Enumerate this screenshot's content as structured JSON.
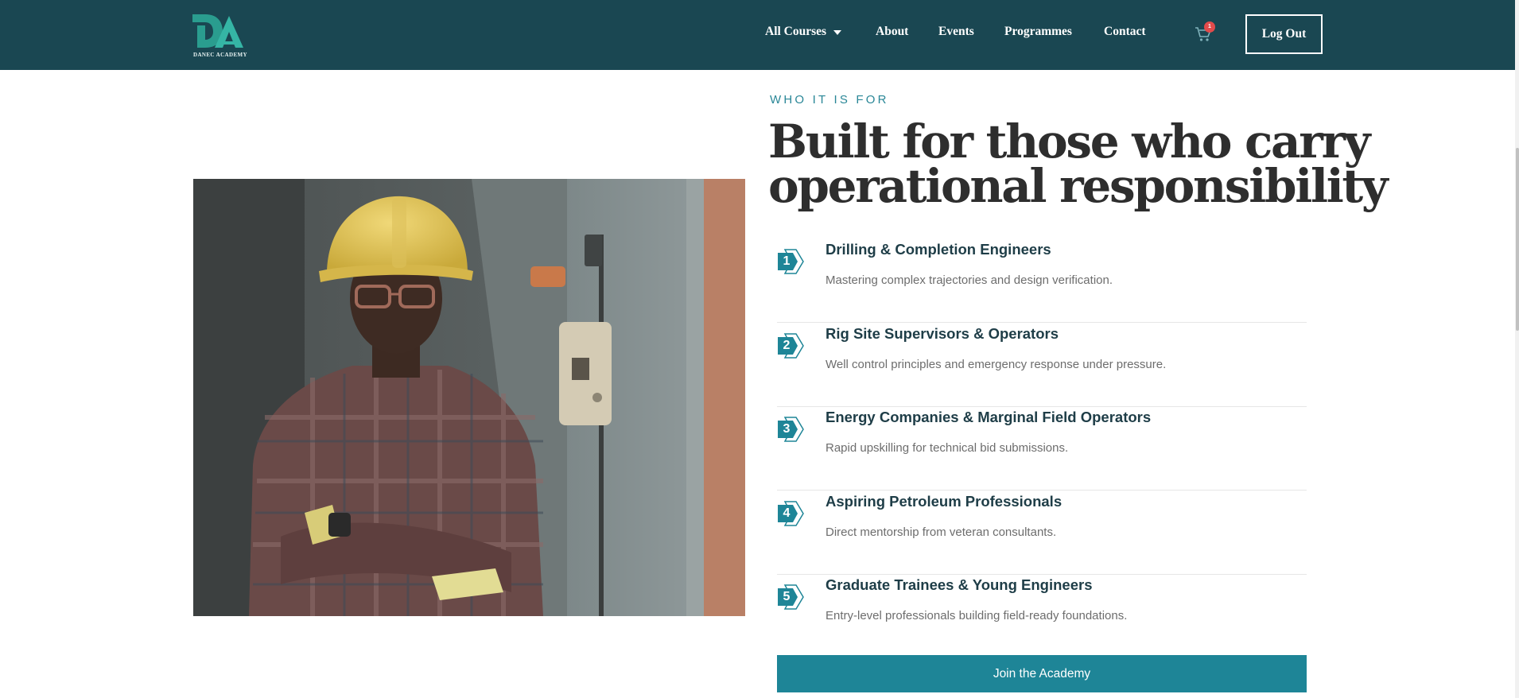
{
  "brand": {
    "logo_text": "DANEC ACADEMY",
    "colors": {
      "nav_bg": "#1a4752",
      "accent": "#1e8597",
      "logo_teal": "#2a9d8f"
    }
  },
  "nav": {
    "items": [
      {
        "label": "All Courses",
        "has_dropdown": true
      },
      {
        "label": "About"
      },
      {
        "label": "Events"
      },
      {
        "label": "Programmes"
      },
      {
        "label": "Contact"
      }
    ],
    "cart": {
      "icon": "cart-icon",
      "count": "1"
    },
    "logout_label": "Log Out"
  },
  "section": {
    "eyebrow": "WHO IT IS FOR",
    "headline_line1": "Built for those who carry",
    "headline_line2": "operational responsibility",
    "image": {
      "icon": "worker-photo"
    },
    "items": [
      {
        "num": "1",
        "title": "Drilling & Completion Engineers",
        "desc": "Mastering complex trajectories and design verification."
      },
      {
        "num": "2",
        "title": "Rig Site Supervisors & Operators",
        "desc": "Well control principles and emergency response under pressure."
      },
      {
        "num": "3",
        "title": "Energy Companies & Marginal Field Operators",
        "desc": "Rapid upskilling for technical bid submissions."
      },
      {
        "num": "4",
        "title": "Aspiring Petroleum Professionals",
        "desc": "Direct mentorship from veteran consultants."
      },
      {
        "num": "5",
        "title": "Graduate Trainees & Young Engineers",
        "desc": "Entry-level professionals building field-ready foundations."
      }
    ],
    "cta_label": "Join the Academy"
  }
}
